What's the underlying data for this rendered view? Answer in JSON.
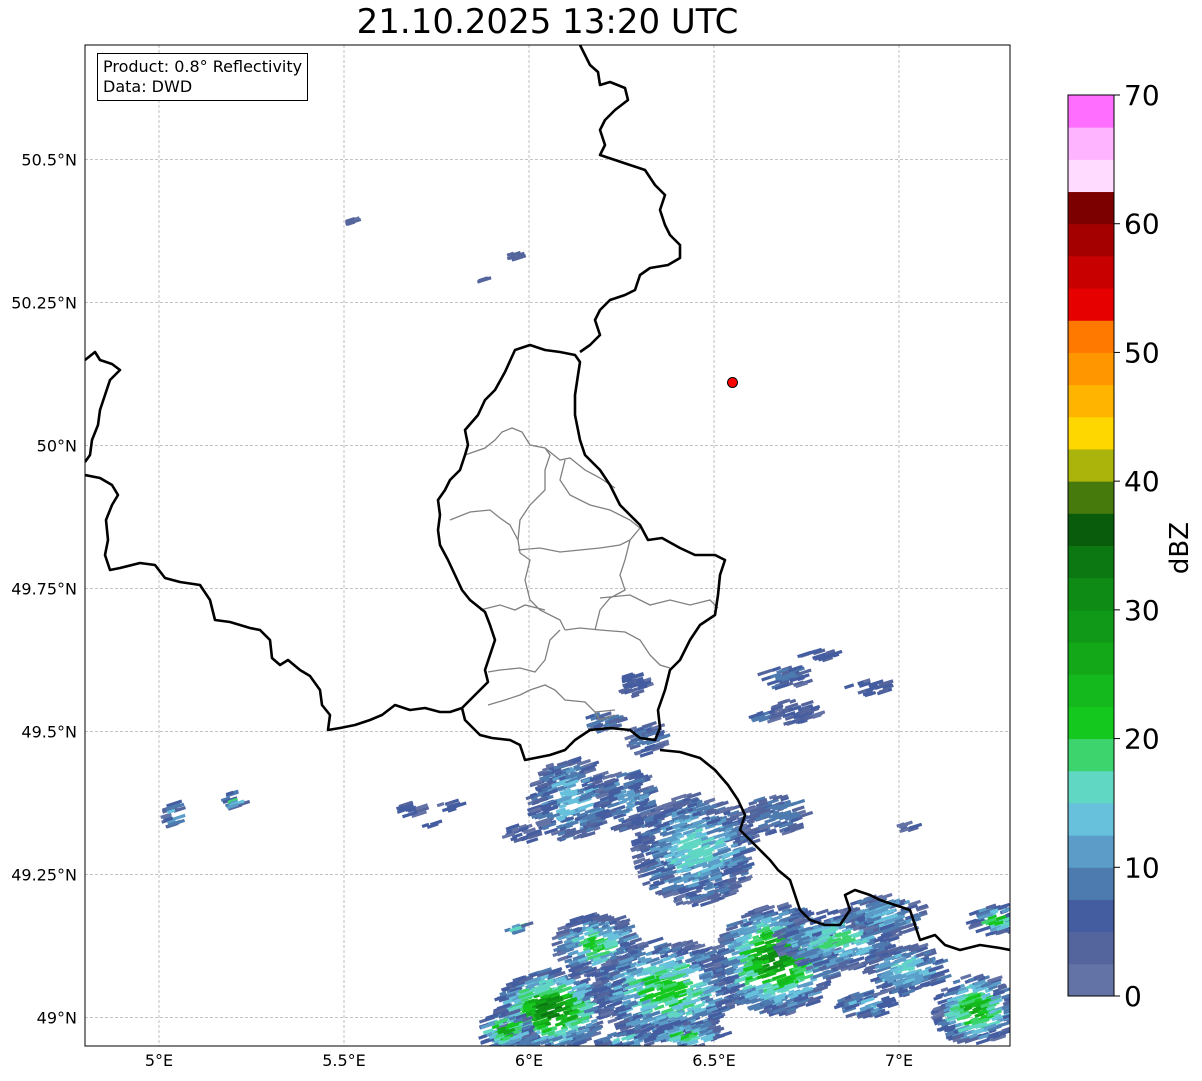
{
  "title": "21.10.2025 13:20 UTC",
  "info": {
    "product": "Product: 0.8° Reflectivity",
    "data": "Data: DWD"
  },
  "map": {
    "extent": {
      "lon_min": 4.8,
      "lon_max": 7.3,
      "lat_min": 48.95,
      "lat_max": 50.7
    },
    "lon_ticks": [
      {
        "value": 5.0,
        "label": "5°E"
      },
      {
        "value": 5.5,
        "label": "5.5°E"
      },
      {
        "value": 6.0,
        "label": "6°E"
      },
      {
        "value": 6.5,
        "label": "6.5°E"
      },
      {
        "value": 7.0,
        "label": "7°E"
      }
    ],
    "lat_ticks": [
      {
        "value": 49.0,
        "label": "49°N"
      },
      {
        "value": 49.25,
        "label": "49.25°N"
      },
      {
        "value": 49.5,
        "label": "49.5°N"
      },
      {
        "value": 49.75,
        "label": "49.75°N"
      },
      {
        "value": 50.0,
        "label": "50°N"
      },
      {
        "value": 50.25,
        "label": "50.25°N"
      },
      {
        "value": 50.5,
        "label": "50.5°N"
      }
    ],
    "grid": true,
    "marker": {
      "lon": 6.55,
      "lat": 50.11,
      "color": "#ff0000"
    }
  },
  "colorbar": {
    "unit": "dBZ",
    "min": 0,
    "max": 70,
    "step": 2.5,
    "tick_labels": [
      "0",
      "10",
      "20",
      "30",
      "40",
      "50",
      "60",
      "70"
    ],
    "colors": [
      "#6473a5",
      "#54659d",
      "#445da0",
      "#4d7aaf",
      "#5b9dc8",
      "#67c1dc",
      "#5fd7c2",
      "#3dd46e",
      "#14c81e",
      "#14b91e",
      "#12a818",
      "#109818",
      "#0e8b14",
      "#0b7812",
      "#085c0c",
      "#477a0c",
      "#aab40a",
      "#ffd700",
      "#ffb400",
      "#ff9600",
      "#ff7800",
      "#e60000",
      "#c80000",
      "#a50000",
      "#7d0000",
      "#ffdcff",
      "#ffb4ff",
      "#ff6eff",
      "#ee32ee"
    ]
  }
}
